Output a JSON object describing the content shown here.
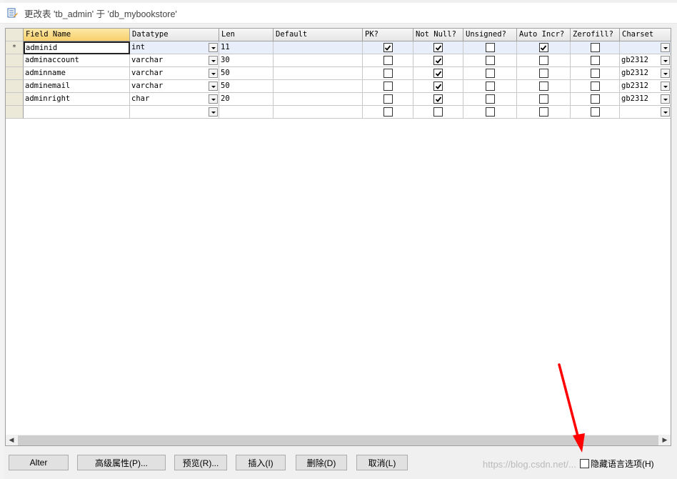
{
  "window": {
    "title": "更改表 'tb_admin' 于 'db_mybookstore'"
  },
  "grid": {
    "columns": [
      "Field Name",
      "Datatype",
      "Len",
      "Default",
      "PK?",
      "Not Null?",
      "Unsigned?",
      "Auto Incr?",
      "Zerofill?",
      "Charset"
    ],
    "rows": [
      {
        "marker": "*",
        "field": "adminid",
        "datatype": "int",
        "len": "11",
        "default": "",
        "pk": true,
        "not_null": true,
        "unsigned": false,
        "auto_incr": true,
        "zerofill": false,
        "charset": ""
      },
      {
        "marker": "",
        "field": "adminaccount",
        "datatype": "varchar",
        "len": "30",
        "default": "",
        "pk": false,
        "not_null": true,
        "unsigned": false,
        "auto_incr": false,
        "zerofill": false,
        "charset": "gb2312"
      },
      {
        "marker": "",
        "field": "adminname",
        "datatype": "varchar",
        "len": "50",
        "default": "",
        "pk": false,
        "not_null": true,
        "unsigned": false,
        "auto_incr": false,
        "zerofill": false,
        "charset": "gb2312"
      },
      {
        "marker": "",
        "field": "adminemail",
        "datatype": "varchar",
        "len": "50",
        "default": "",
        "pk": false,
        "not_null": true,
        "unsigned": false,
        "auto_incr": false,
        "zerofill": false,
        "charset": "gb2312"
      },
      {
        "marker": "",
        "field": "adminright",
        "datatype": "char",
        "len": "20",
        "default": "",
        "pk": false,
        "not_null": true,
        "unsigned": false,
        "auto_incr": false,
        "zerofill": false,
        "charset": "gb2312"
      },
      {
        "marker": "",
        "field": "",
        "datatype": "",
        "len": "",
        "default": "",
        "pk": false,
        "not_null": false,
        "unsigned": false,
        "auto_incr": false,
        "zerofill": false,
        "charset": ""
      }
    ]
  },
  "buttons": {
    "alter": "Alter",
    "advanced": "高级属性(P)...",
    "preview": "预览(R)...",
    "insert": "插入(I)",
    "delete": "删除(D)",
    "cancel": "取消(L)"
  },
  "hide_language_option": {
    "label": "隐藏语言选项(H)",
    "checked": false
  },
  "watermark": "https://blog.csdn.net/...",
  "annotation": {
    "arrow_color": "#ff0000"
  }
}
